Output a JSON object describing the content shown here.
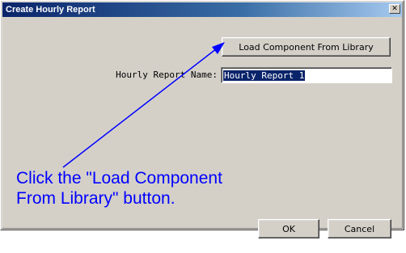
{
  "dialog": {
    "title": "Create Hourly Report",
    "close_symbol": "✕",
    "load_button_label": "Load Component From Library",
    "name_label": "Hourly Report Name:",
    "name_value": "Hourly Report 1",
    "ok_label": "OK",
    "cancel_label": "Cancel"
  },
  "annotation": {
    "text": "Click the \"Load Component From Library\" button.",
    "color": "#0000ff"
  },
  "icons": {
    "close": "close-icon",
    "arrow": "pointer-arrow-icon"
  },
  "colors": {
    "titlebar": "#0a246a",
    "dialog_face": "#d4d0c8",
    "selection": "#0a246a"
  }
}
